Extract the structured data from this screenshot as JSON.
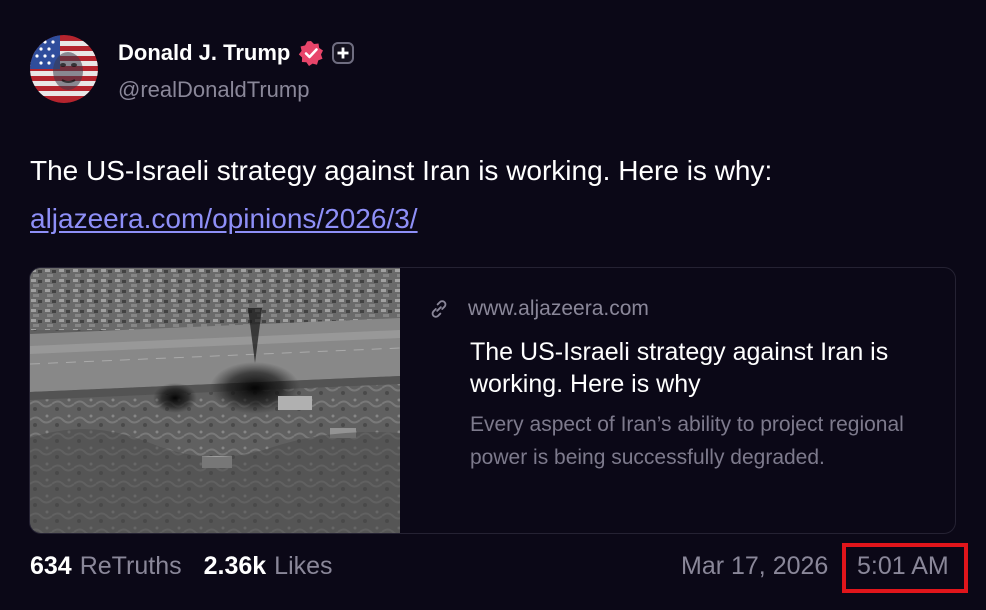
{
  "author": {
    "display_name": "Donald J. Trump",
    "handle": "@realDonaldTrump",
    "verified_icon": "verified-badge-icon",
    "plus_icon": "plus-icon"
  },
  "post": {
    "text": "The US-Israeli strategy against Iran is working. Here is why:",
    "link_text": "aljazeera.com/opinions/2026/3/"
  },
  "link_card": {
    "link_icon": "link-icon",
    "domain": "www.aljazeera.com",
    "title": "The US-Israeli strategy against Iran is working. Here is why",
    "description": "Every aspect of Iran’s ability to project regional power is being successfully degraded."
  },
  "stats": {
    "retruths_count": "634",
    "retruths_label": "ReTruths",
    "likes_count": "2.36k",
    "likes_label": "Likes"
  },
  "timestamp": {
    "date": "Mar 17, 2026",
    "time": "5:01 AM"
  },
  "colors": {
    "background": "#0b0817",
    "link": "#8e8ff7",
    "verified": "#e8456a",
    "highlight_box": "#e0151b",
    "muted_text": "#8a8799"
  }
}
